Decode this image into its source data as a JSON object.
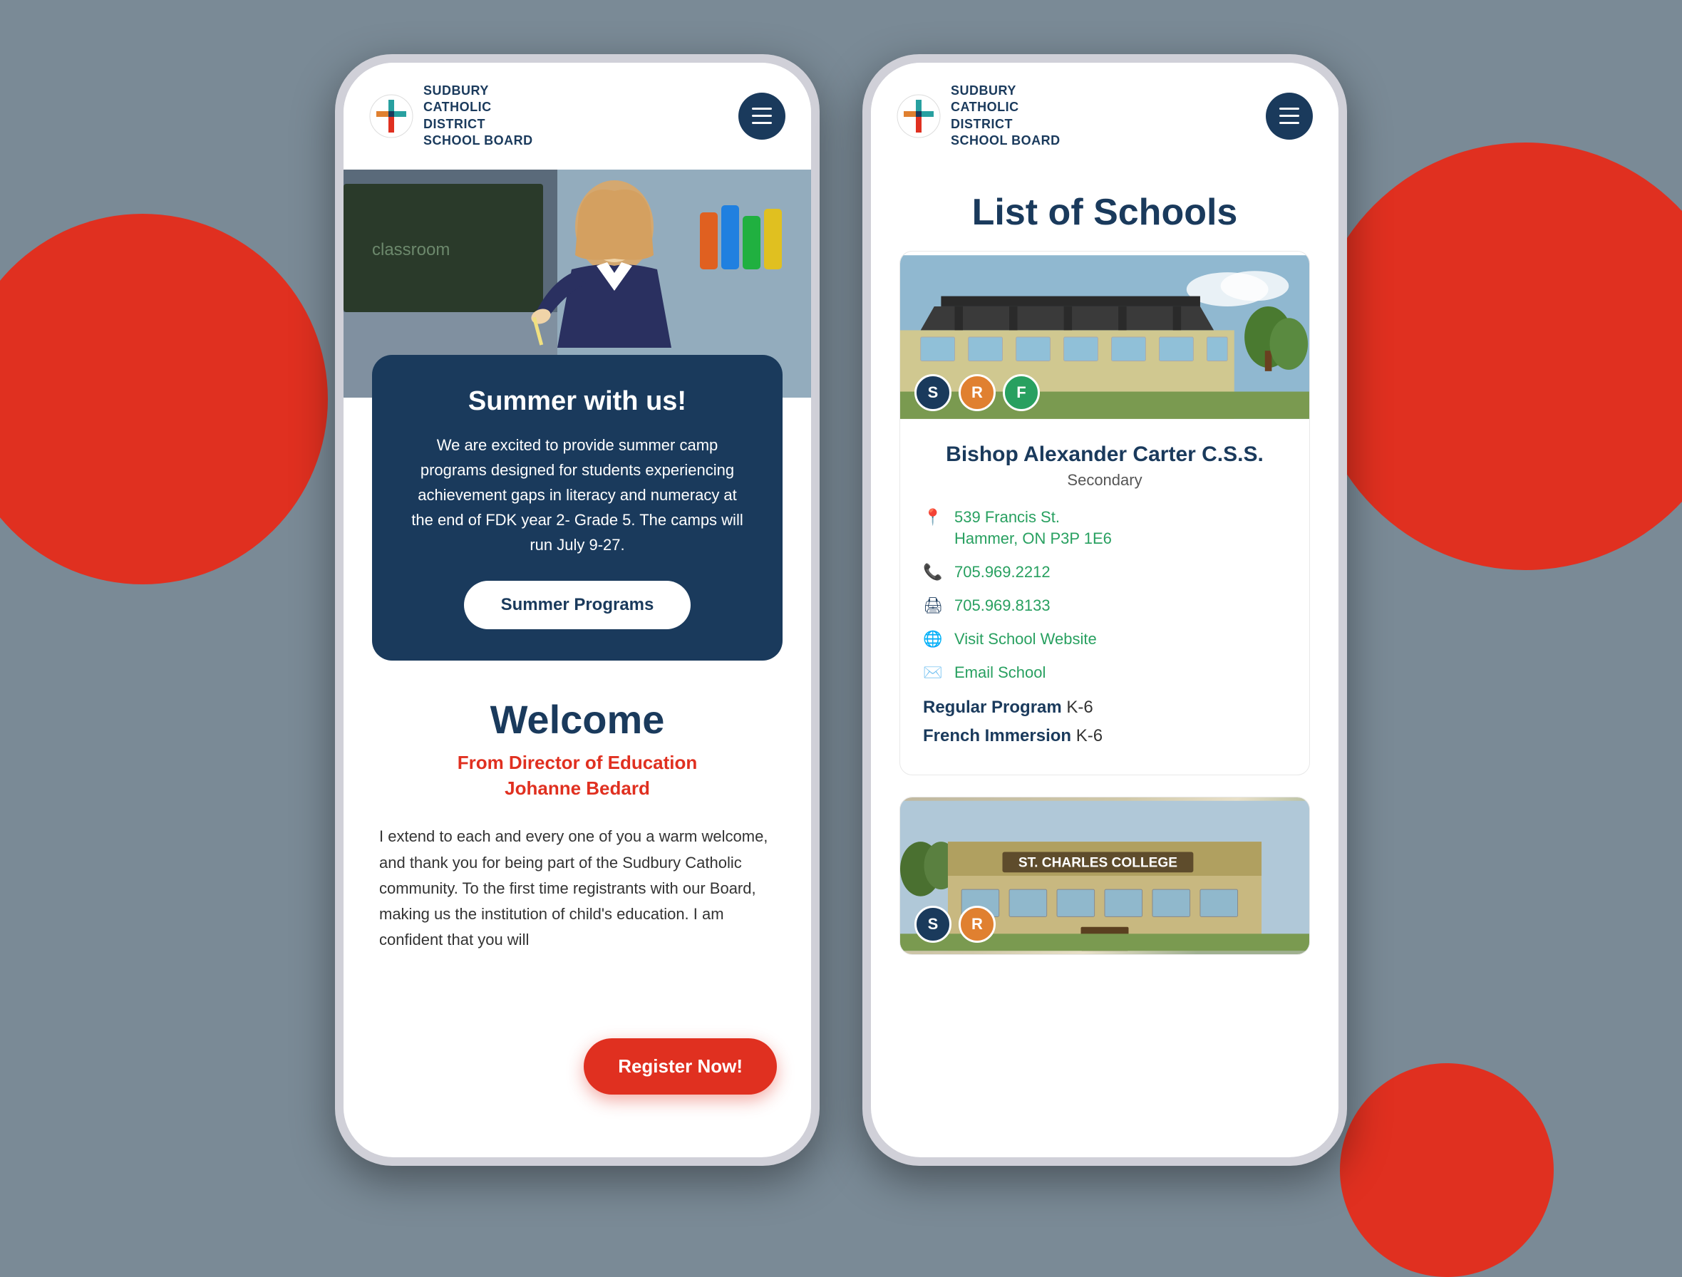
{
  "background_color": "#7a8a96",
  "brand": {
    "name_line1": "SUDBURY",
    "name_line2": "CATHOLIC",
    "name_line3": "DISTRICT",
    "name_line4": "SCHOOL BOARD"
  },
  "phone1": {
    "hero_alt": "Student in classroom",
    "summer_card": {
      "title": "Summer with us!",
      "body": "We are excited to provide summer camp programs designed for students experiencing achievement gaps in literacy and numeracy at the end of FDK year 2- Grade 5. The camps will run July 9-27.",
      "button_label": "Summer Programs"
    },
    "welcome": {
      "title": "Welcome",
      "subtitle_line1": "From Director of Education",
      "subtitle_line2": "Johanne Bedard",
      "body": "I extend to each and every one of you a warm welcome, and thank you for being part of the Sudbury Catholic community. To the first time registrants with our Board, making us the institution of child's education. I am confident that you will"
    },
    "register_button": "Register Now!"
  },
  "phone2": {
    "page_title": "List of Schools",
    "school1": {
      "name": "Bishop Alexander Carter C.S.S.",
      "type": "Secondary",
      "badges": [
        "S",
        "R",
        "F"
      ],
      "address_line1": "539 Francis St.",
      "address_line2": "Hammer, ON P3P 1E6",
      "phone": "705.969.2212",
      "fax": "705.969.8133",
      "website_label": "Visit School Website",
      "email_label": "Email School",
      "programs": [
        {
          "label": "Regular Program",
          "value": "K-6"
        },
        {
          "label": "French Immersion",
          "value": "K-6"
        }
      ]
    },
    "school2": {
      "name": "St. Charles College",
      "badges": [
        "S",
        "R"
      ]
    }
  }
}
